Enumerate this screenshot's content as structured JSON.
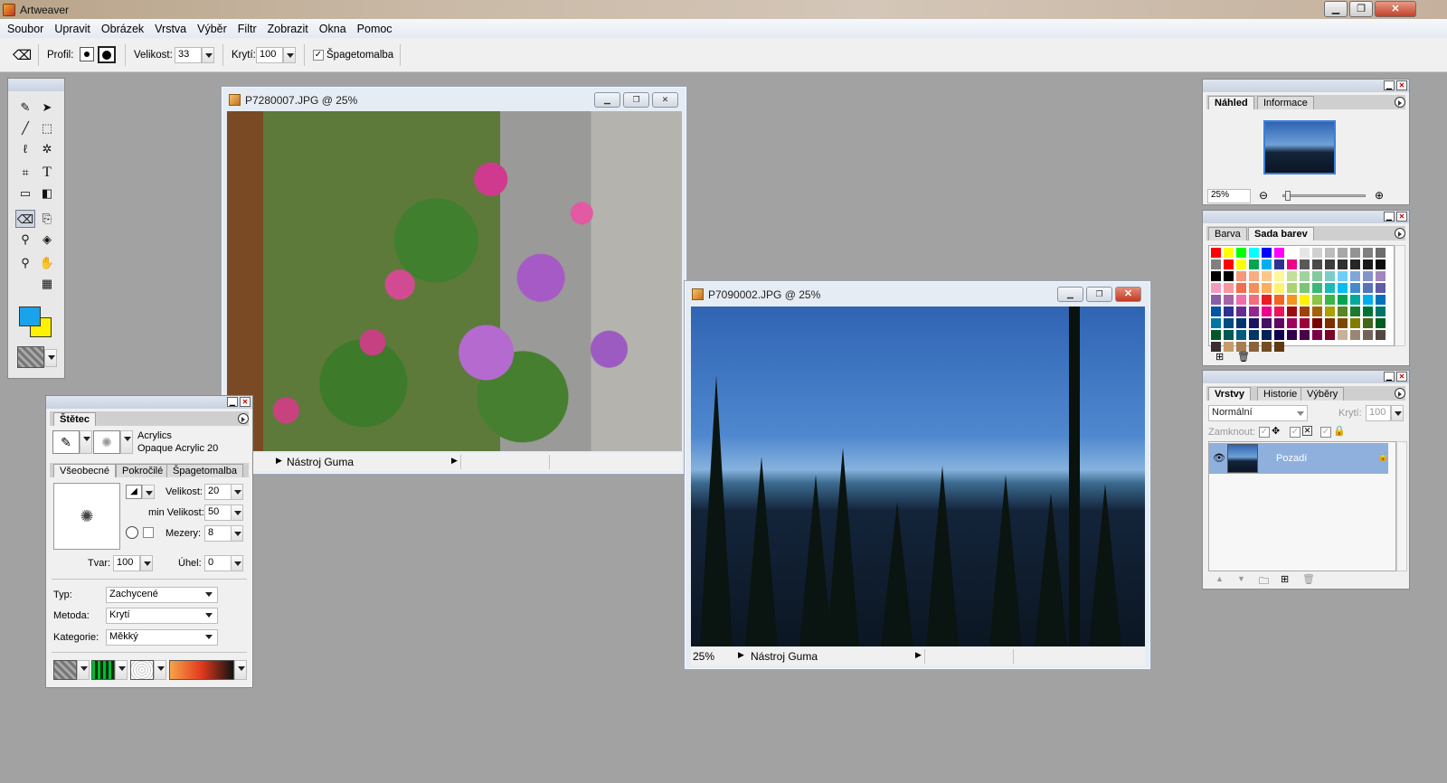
{
  "window": {
    "title": "Artweaver",
    "btn_min": "▁",
    "btn_max": "❐",
    "btn_close": "✕"
  },
  "menu": [
    "Soubor",
    "Upravit",
    "Obrázek",
    "Vrstva",
    "Výběr",
    "Filtr",
    "Zobrazit",
    "Okna",
    "Pomoc"
  ],
  "options": {
    "profile_label": "Profil:",
    "size_label": "Velikost:",
    "size_value": "33",
    "opacity_label": "Krytí:",
    "opacity_value": "100",
    "spaghetti_label": "Špagetomalba",
    "spaghetti_checked": "✓"
  },
  "toolbox": {
    "tools": [
      "brush",
      "move",
      "line",
      "rect-select",
      "lasso",
      "magic-wand",
      "crop",
      "text",
      "rectangle",
      "gradient",
      "eraser",
      "clone",
      "eyedropper",
      "fill",
      "zoom",
      "hand",
      "grid"
    ],
    "foreground": "#1aa3ea",
    "background": "#fff200"
  },
  "doc1": {
    "title": "P7280007.JPG @ 25%",
    "status_tool": "Nástroj Guma"
  },
  "doc2": {
    "title": "P7090002.JPG @ 25%",
    "zoom": "25%",
    "status_tool": "Nástroj Guma"
  },
  "brush_panel": {
    "tab": "Štětec",
    "brush_category": "Acrylics",
    "brush_name": "Opaque Acrylic 20",
    "tabs": [
      "Všeobecné",
      "Pokročilé",
      "Špagetomalba"
    ],
    "size_label": "Velikost:",
    "size_value": "20",
    "min_size_label": "min Velikost:",
    "min_size_value": "50",
    "spacing_label": "Mezery:",
    "spacing_value": "8",
    "shape_label": "Tvar:",
    "shape_value": "100",
    "angle_label": "Úhel:",
    "angle_value": "0",
    "type_label": "Typ:",
    "type_value": "Zachycené",
    "method_label": "Metoda:",
    "method_value": "Krytí",
    "category_label": "Kategorie:",
    "category_value": "Měkký"
  },
  "navigator": {
    "tabs": [
      "Náhled",
      "Informace"
    ],
    "zoom": "25%"
  },
  "color_panel": {
    "tabs": [
      "Barva",
      "Sada barev"
    ]
  },
  "layers_panel": {
    "tabs": [
      "Vrstvy",
      "Historie",
      "Výběry"
    ],
    "blend_mode": "Normální",
    "opacity_label": "Krytí:",
    "opacity_value": "100",
    "lock_label": "Zamknout:",
    "layer_name": "Pozadí"
  },
  "swatches": [
    "#ff0000",
    "#ffff00",
    "#00ff00",
    "#00ffff",
    "#0000ff",
    "#ff00ff",
    "#ffffff",
    "#e6e6e6",
    "#d0d0d0",
    "#bcbcbc",
    "#a8a8a8",
    "#949494",
    "#808080",
    "#6c6c6c",
    "#808080",
    "#ff0000",
    "#ffff00",
    "#00a651",
    "#00aeef",
    "#2e3192",
    "#ec008c",
    "#595959",
    "#4a4a4a",
    "#3d3d3d",
    "#303030",
    "#262626",
    "#1a1a1a",
    "#0d0d0d",
    "#000000",
    "#000000",
    "#f7977a",
    "#f9ad81",
    "#fdc68a",
    "#fff79a",
    "#c4df9b",
    "#a2d39c",
    "#82ca9d",
    "#7bcdc8",
    "#6ecff6",
    "#7ea7d8",
    "#8493ca",
    "#a187be",
    "#f49ac2",
    "#f6989d",
    "#f26c4f",
    "#f68e55",
    "#fbaf5c",
    "#fff467",
    "#acd372",
    "#7cc576",
    "#3bb878",
    "#1abbb4",
    "#00bff3",
    "#438ccb",
    "#5574b9",
    "#605ca8",
    "#855fa8",
    "#a763a8",
    "#f06eaa",
    "#f26d7d",
    "#ed1c24",
    "#f26522",
    "#f7941d",
    "#fff200",
    "#8dc63f",
    "#39b54a",
    "#00a651",
    "#00a99d",
    "#00aeef",
    "#0072bc",
    "#0054a6",
    "#2e3192",
    "#662d91",
    "#92278f",
    "#ec008c",
    "#ed145b",
    "#9e0b0f",
    "#a0410d",
    "#a36209",
    "#aba000",
    "#598527",
    "#1a7b30",
    "#007236",
    "#00746b",
    "#0076a3",
    "#004b80",
    "#003471",
    "#1b1464",
    "#440e62",
    "#630460",
    "#9e005d",
    "#9e0039",
    "#790000",
    "#7b2e00",
    "#7d4900",
    "#827b00",
    "#406618",
    "#005e20",
    "#005826",
    "#005952",
    "#005b7f",
    "#003663",
    "#002157",
    "#0d004c",
    "#32004b",
    "#4b0049",
    "#7b0046",
    "#7a0026",
    "#c7b299",
    "#998675",
    "#736357",
    "#534741",
    "#37302d",
    "#c69c6d",
    "#a67c52",
    "#8c6239",
    "#754c24",
    "#603913"
  ]
}
